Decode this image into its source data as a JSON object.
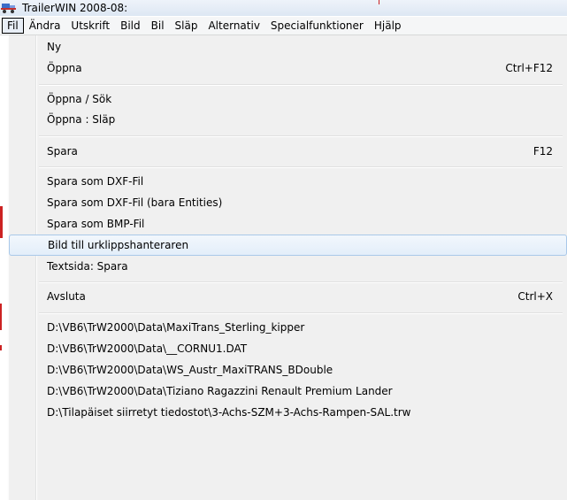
{
  "window": {
    "title": "TrailerWIN 2008-08:"
  },
  "menubar": {
    "items": [
      {
        "label": "Fil",
        "active": true
      },
      {
        "label": "Ändra"
      },
      {
        "label": "Utskrift"
      },
      {
        "label": "Bild"
      },
      {
        "label": "Bil"
      },
      {
        "label": "Släp"
      },
      {
        "label": "Alternativ"
      },
      {
        "label": "Specialfunktioner"
      },
      {
        "label": "Hjälp"
      }
    ]
  },
  "file_menu": {
    "items": [
      {
        "label": "Ny",
        "shortcut": ""
      },
      {
        "label": "Öppna",
        "shortcut": "Ctrl+F12"
      },
      {
        "label": "Öppna / Sök",
        "shortcut": ""
      },
      {
        "label": "Öppna : Släp",
        "shortcut": ""
      },
      {
        "label": "Spara",
        "shortcut": "F12"
      },
      {
        "label": "Spara som DXF-Fil",
        "shortcut": ""
      },
      {
        "label": "Spara som DXF-Fil (bara Entities)",
        "shortcut": ""
      },
      {
        "label": "Spara som BMP-Fil",
        "shortcut": ""
      },
      {
        "label": "Bild till urklippshanteraren",
        "shortcut": "",
        "highlighted": true
      },
      {
        "label": "Textsida: Spara",
        "shortcut": ""
      },
      {
        "label": "Avsluta",
        "shortcut": "Ctrl+X"
      },
      {
        "label": "D:\\VB6\\TrW2000\\Data\\MaxiTrans_Sterling_kipper",
        "shortcut": ""
      },
      {
        "label": "D:\\VB6\\TrW2000\\Data\\__CORNU1.DAT",
        "shortcut": ""
      },
      {
        "label": "D:\\VB6\\TrW2000\\Data\\WS_Austr_MaxiTRANS_BDouble",
        "shortcut": ""
      },
      {
        "label": "D:\\VB6\\TrW2000\\Data\\Tiziano Ragazzini Renault Premium Lander",
        "shortcut": ""
      },
      {
        "label": "D:\\Tilapäiset siirretyt tiedostot\\3-Achs-SZM+3-Achs-Rampen-SAL.trw",
        "shortcut": ""
      }
    ]
  },
  "colors": {
    "highlight_border": "#a9c8e9",
    "menu_background": "#f0f0f0"
  },
  "icons": {
    "app": "trailer-app-icon"
  }
}
